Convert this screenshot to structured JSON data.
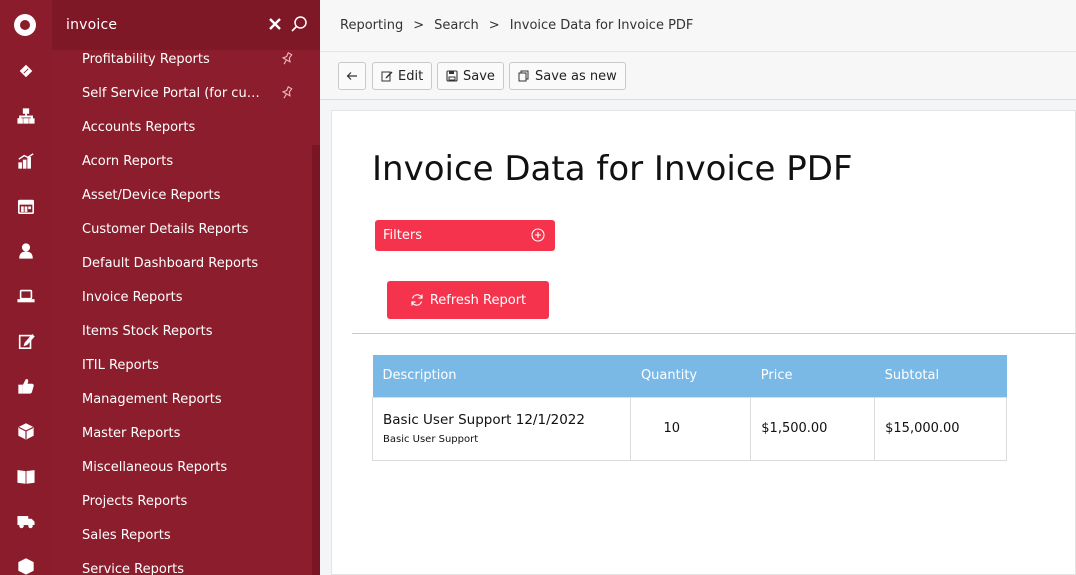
{
  "search": {
    "query": "invoice"
  },
  "menu": {
    "items": [
      {
        "label": "Profitability Reports",
        "pinned": true
      },
      {
        "label": "Self Service Portal (for cust...",
        "pinned": true
      },
      {
        "label": "Accounts Reports"
      },
      {
        "label": "Acorn Reports"
      },
      {
        "label": "Asset/Device Reports"
      },
      {
        "label": "Customer Details Reports"
      },
      {
        "label": "Default Dashboard Reports"
      },
      {
        "label": "Invoice Reports"
      },
      {
        "label": "Items Stock Reports"
      },
      {
        "label": "ITIL Reports"
      },
      {
        "label": "Management Reports"
      },
      {
        "label": "Master Reports"
      },
      {
        "label": "Miscellaneous Reports"
      },
      {
        "label": "Projects Reports"
      },
      {
        "label": "Sales Reports"
      },
      {
        "label": "Service Reports"
      }
    ]
  },
  "rail_icons": [
    "logo-icon",
    "ticket-icon",
    "org-chart-icon",
    "chart-icon",
    "calendar-icon",
    "user-icon",
    "laptop-icon",
    "edit-icon",
    "thumbs-up-icon",
    "box-icon",
    "book-icon",
    "truck-icon",
    "package-icon"
  ],
  "breadcrumb": {
    "items": [
      "Reporting",
      "Search",
      "Invoice Data for Invoice PDF"
    ],
    "separator": ">"
  },
  "toolbar": {
    "edit_label": "Edit",
    "save_label": "Save",
    "save_as_new_label": "Save as new"
  },
  "page": {
    "title": "Invoice Data for Invoice PDF",
    "filters_label": "Filters",
    "refresh_label": "Refresh Report"
  },
  "table": {
    "headers": [
      "Description",
      "Quantity",
      "Price",
      "Subtotal"
    ],
    "rows": [
      {
        "description": "Basic User Support 12/1/2022",
        "sub": "Basic User Support",
        "quantity": "10",
        "price": "$1,500.00",
        "subtotal": "$15,000.00"
      }
    ]
  },
  "colors": {
    "sidebar": "#8c1d2c",
    "accent": "#f5334d",
    "table_header": "#7ab8e6"
  }
}
